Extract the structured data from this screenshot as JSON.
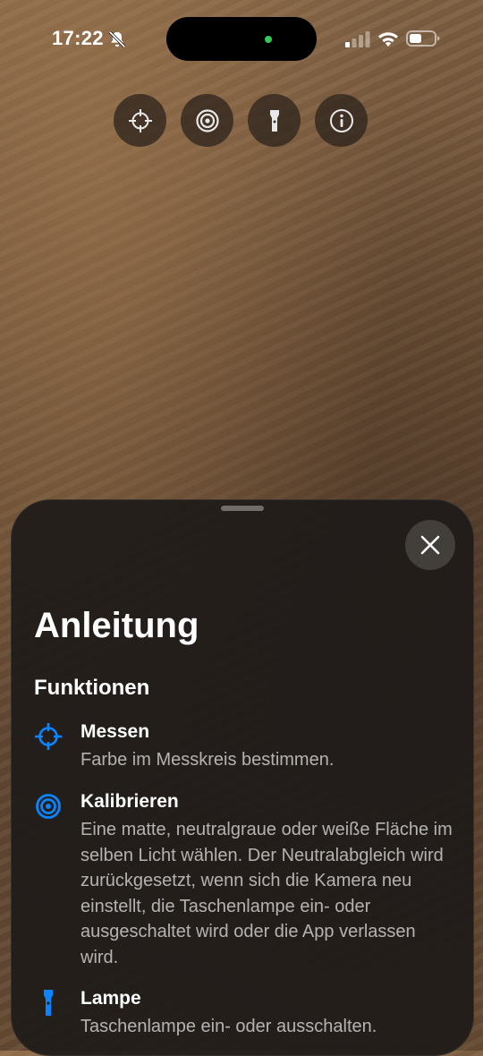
{
  "status_bar": {
    "time": "17:22",
    "signal_icon": "cellular-signal-icon",
    "wifi_icon": "wifi-icon",
    "battery_icon": "battery-icon",
    "silent_icon": "bell-slash-icon",
    "battery_level": 0.5
  },
  "toolbar": {
    "buttons": [
      {
        "icon": "crosshair-icon"
      },
      {
        "icon": "target-icon"
      },
      {
        "icon": "flashlight-icon"
      },
      {
        "icon": "info-icon"
      }
    ]
  },
  "sheet": {
    "title": "Anleitung",
    "section_title": "Funktionen",
    "close_icon": "close-icon",
    "features": [
      {
        "icon": "crosshair-icon",
        "name": "Messen",
        "description": "Farbe im Messkreis bestimmen."
      },
      {
        "icon": "target-icon",
        "name": "Kalibrieren",
        "description": "Eine matte, neutralgraue oder weiße Fläche im selben Licht wählen. Der Neutralabgleich wird zurückgesetzt, wenn sich die Kamera neu einstellt, die Taschenlampe ein- oder ausgeschaltet wird oder die App verlassen wird."
      },
      {
        "icon": "flashlight-icon",
        "name": "Lampe",
        "description": "Taschenlampe ein- oder ausschalten."
      }
    ]
  },
  "colors": {
    "accent": "#0a84ff",
    "sheet_background": "#1e1b19",
    "secondary_text": "#bdbdbd"
  }
}
